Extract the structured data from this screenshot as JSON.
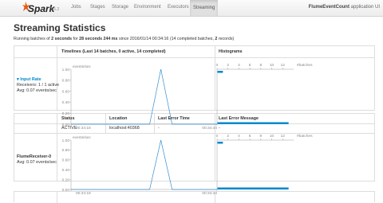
{
  "navbar": {
    "logo_text": "Spark",
    "version": "1.5.2",
    "tabs": [
      {
        "label": "Jobs"
      },
      {
        "label": "Stages"
      },
      {
        "label": "Storage"
      },
      {
        "label": "Environment"
      },
      {
        "label": "Executors"
      },
      {
        "label": "Streaming"
      }
    ],
    "active_tab": "Streaming",
    "app_name": "FlumeEventCount",
    "app_suffix": "application UI"
  },
  "page": {
    "title": "Streaming Statistics",
    "subtitle": {
      "p1": "Running batches of ",
      "interval": "2 seconds",
      "p2": " for ",
      "duration": "28 seconds 244 ms",
      "p3": " since 2016/01/14 00:34:16 (14 completed batches, ",
      "records": "2",
      "p4": " records)"
    }
  },
  "stats_table": {
    "headers": {
      "timelines": "Timelines (Last 14 batches, 0 active, 14 completed)",
      "histograms": "Histograms"
    },
    "input_rate": {
      "label": "Input Rate",
      "receivers": "Receivers: 1 / 1 active",
      "avg": "Avg: 0.07 events/sec"
    }
  },
  "receivers_table": {
    "headers": {
      "status": "Status",
      "location": "Location",
      "last_error_time": "Last Error Time",
      "last_error_message": "Last Error Message"
    },
    "row": {
      "status": "ACTIVE",
      "location": "localhost:40368",
      "last_error_time": "-",
      "last_error_message": "-"
    },
    "receiver": {
      "name": "FlumeReceiver-0",
      "avg": "Avg: 0.07 events/sec"
    }
  },
  "chart_data": [
    {
      "type": "line",
      "ylabel": "events/sec",
      "yticks": [
        "1.00",
        "0.80",
        "0.60",
        "0.40",
        "0.20",
        "0.00"
      ],
      "ylim": [
        0,
        1
      ],
      "xtick_labels": [
        "00:34:18",
        "00:34:44"
      ],
      "x": [
        "00:34:18",
        "00:34:20",
        "00:34:22",
        "00:34:24",
        "00:34:26",
        "00:34:28",
        "00:34:30",
        "00:34:32",
        "00:34:34",
        "00:34:36",
        "00:34:38",
        "00:34:40",
        "00:34:42",
        "00:34:44"
      ],
      "values": [
        0,
        0,
        0,
        0,
        0,
        0,
        0,
        0,
        1,
        0,
        0,
        0,
        0,
        0
      ]
    },
    {
      "type": "bar",
      "orientation": "horizontal",
      "xlabel": "#batches",
      "xticks": [
        "0",
        "2",
        "4",
        "6",
        "8",
        "10",
        "12"
      ],
      "xlim": [
        0,
        14
      ],
      "bins": [
        {
          "range": "1.00",
          "count": 1
        },
        {
          "range": "0.00",
          "count": 13
        }
      ]
    },
    {
      "type": "line",
      "ylabel": "events/sec",
      "yticks": [
        "1.00",
        "0.80",
        "0.60",
        "0.40",
        "0.20",
        "0.00"
      ],
      "ylim": [
        0,
        1
      ],
      "xtick_labels": [
        "00:34:18",
        "00:34:44"
      ],
      "x": [
        "00:34:18",
        "00:34:20",
        "00:34:22",
        "00:34:24",
        "00:34:26",
        "00:34:28",
        "00:34:30",
        "00:34:32",
        "00:34:34",
        "00:34:36",
        "00:34:38",
        "00:34:40",
        "00:34:42",
        "00:34:44"
      ],
      "values": [
        0,
        0,
        0,
        0,
        0,
        0,
        0,
        0,
        1,
        0,
        0,
        0,
        0,
        0
      ]
    },
    {
      "type": "bar",
      "orientation": "horizontal",
      "xlabel": "#batches",
      "xticks": [
        "0",
        "2",
        "4",
        "6",
        "8",
        "10",
        "12"
      ],
      "xlim": [
        0,
        14
      ],
      "bins": [
        {
          "range": "1.00",
          "count": 1
        },
        {
          "range": "0.00",
          "count": 13
        }
      ]
    }
  ],
  "colors": {
    "accent": "#0088cc",
    "chart_line": "#3a8fd0",
    "bar": "#0088cc"
  }
}
